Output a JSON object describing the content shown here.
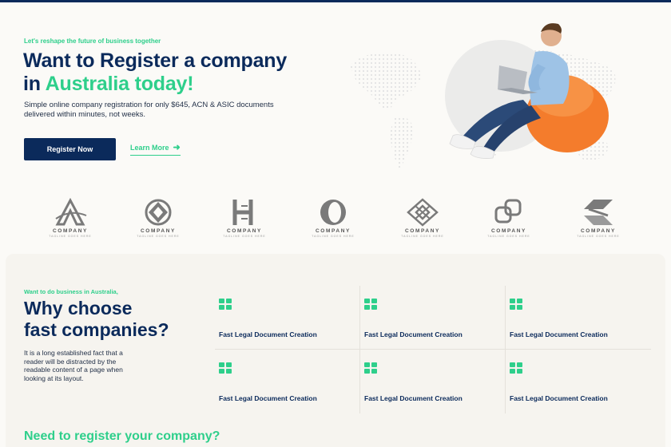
{
  "hero": {
    "eyebrow": "Let's reshape the future of business together",
    "title_line1": "Want to Register a company",
    "title_line2_prefix": "in ",
    "title_line2_highlight": "Australia today!",
    "subtitle": "Simple online company registration for only $645, ACN & ASIC documents delivered within minutes, not weeks.",
    "primary_button": "Register Now",
    "secondary_link": "Learn More",
    "secondary_icon": "arrow-right-icon"
  },
  "logos": [
    {
      "word": "COMPANY",
      "tag": "TAGLINE GOES HERE",
      "icon": "triangle-logo-icon"
    },
    {
      "word": "COMPANY",
      "tag": "TAGLINE GOES HERE",
      "icon": "diamond-ring-logo-icon"
    },
    {
      "word": "COMPANY",
      "tag": "TAGLINE GOES HERE",
      "icon": "h-letter-logo-icon"
    },
    {
      "word": "COMPANY",
      "tag": "TAGLINE GOES HERE",
      "icon": "swirl-logo-icon"
    },
    {
      "word": "COMPANY",
      "tag": "TAGLINE GOES HERE",
      "icon": "lattice-logo-icon"
    },
    {
      "word": "COMPANY",
      "tag": "TAGLINE GOES HERE",
      "icon": "linked-squares-logo-icon"
    },
    {
      "word": "COMPANY",
      "tag": "TAGLINE GOES HERE",
      "icon": "chevron-s-logo-icon"
    }
  ],
  "features": {
    "eyebrow": "Want to do business in Australia,",
    "title_line1": "Why choose",
    "title_line2": "fast companies?",
    "body": "It is a long established fact that a reader will be distracted by the readable content of a page when looking at its layout.",
    "items": [
      {
        "label": "Fast Legal Document Creation",
        "icon": "grid-icon"
      },
      {
        "label": "Fast Legal Document Creation",
        "icon": "grid-icon"
      },
      {
        "label": "Fast Legal Document Creation",
        "icon": "grid-icon"
      },
      {
        "label": "Fast Legal Document Creation",
        "icon": "grid-icon"
      },
      {
        "label": "Fast Legal Document Creation",
        "icon": "grid-icon"
      },
      {
        "label": "Fast Legal Document Creation",
        "icon": "grid-icon"
      }
    ]
  },
  "next_section": {
    "title": "Need to register your company?"
  },
  "colors": {
    "navy": "#0b2a5b",
    "green": "#2ecf8b",
    "background": "#fbfaf7",
    "orange": "#f47c2c"
  }
}
